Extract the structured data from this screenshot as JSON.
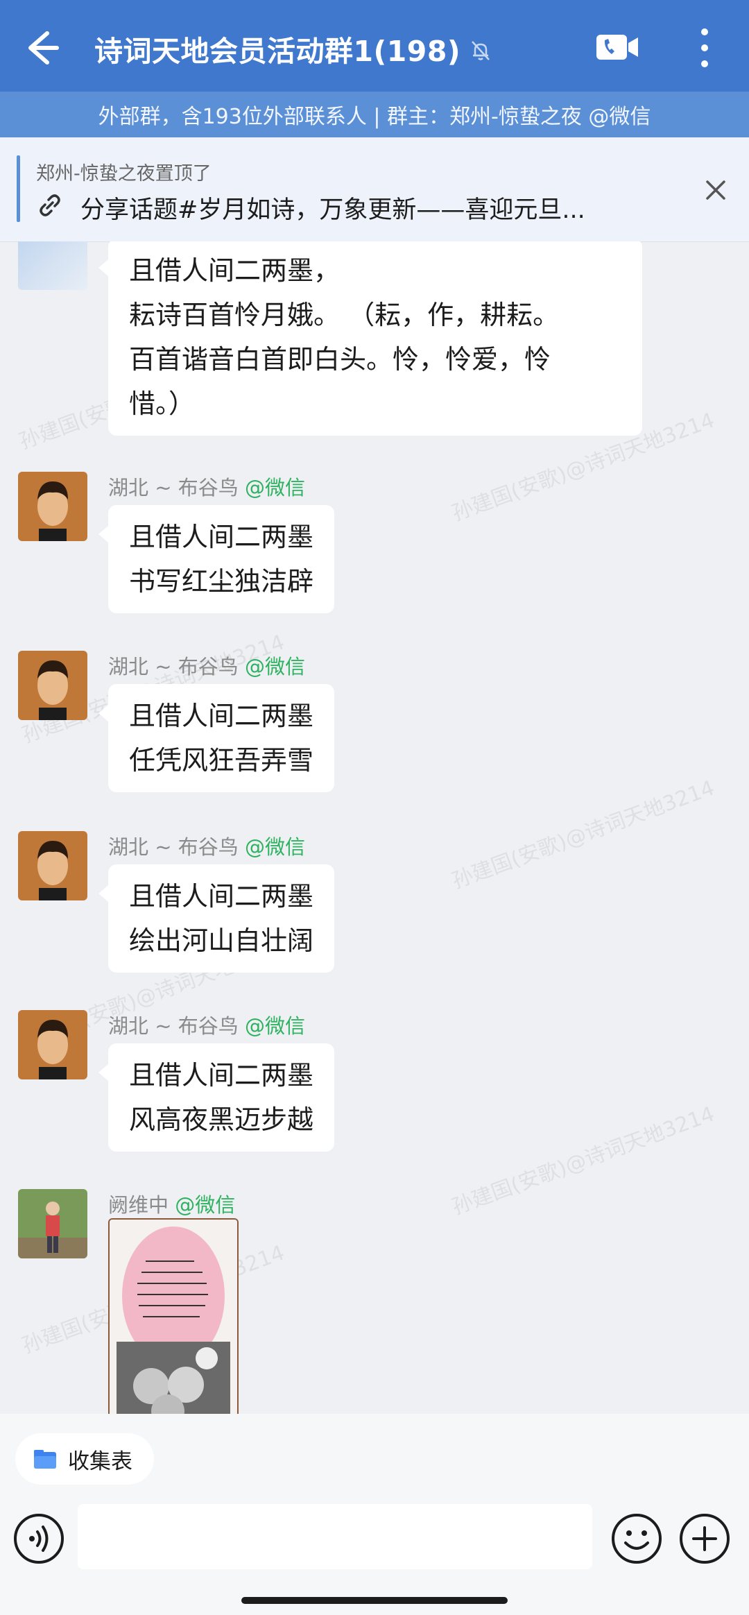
{
  "header": {
    "title": "诗词天地会员活动群1(198)",
    "subtitle": "外部群，含193位外部联系人 | 群主：郑州-惊蛰之夜 @微信",
    "accent_color": "#3f78cc",
    "icons": [
      "back-arrow-icon",
      "mute-bell-icon",
      "video-call-icon",
      "more-vert-icon"
    ]
  },
  "pinned": {
    "who": "郑州-惊蛰之夜置顶了",
    "text": "分享话题#岁月如诗，万象更新——喜迎元旦..."
  },
  "messages": [
    {
      "lines": [
        "且借人间二两墨，",
        "耘诗百首怜月娥。 （耘，作，耕耘。",
        "百首谐音白首即白头。怜，怜爱，怜",
        "惜。）"
      ]
    },
    {
      "sender": "湖北 ~ 布谷鸟",
      "source": "@微信",
      "lines": [
        "且借人间二两墨",
        "书写红尘独洁辟"
      ]
    },
    {
      "sender": "湖北 ~ 布谷鸟",
      "source": "@微信",
      "lines": [
        "且借人间二两墨",
        "任凭风狂吾弄雪"
      ]
    },
    {
      "sender": "湖北 ~ 布谷鸟",
      "source": "@微信",
      "lines": [
        "且借人间二两墨",
        "绘出河山自壮阔"
      ]
    },
    {
      "sender": "湖北 ~ 布谷鸟",
      "source": "@微信",
      "lines": [
        "且借人间二两墨",
        "风高夜黑迈步越"
      ]
    },
    {
      "sender": "阙维中",
      "source": "@微信",
      "type": "image"
    }
  ],
  "watermark": "孙建国(安歌)@诗词天地3214",
  "bottom": {
    "collect_label": "收集表",
    "input_placeholder": ""
  }
}
